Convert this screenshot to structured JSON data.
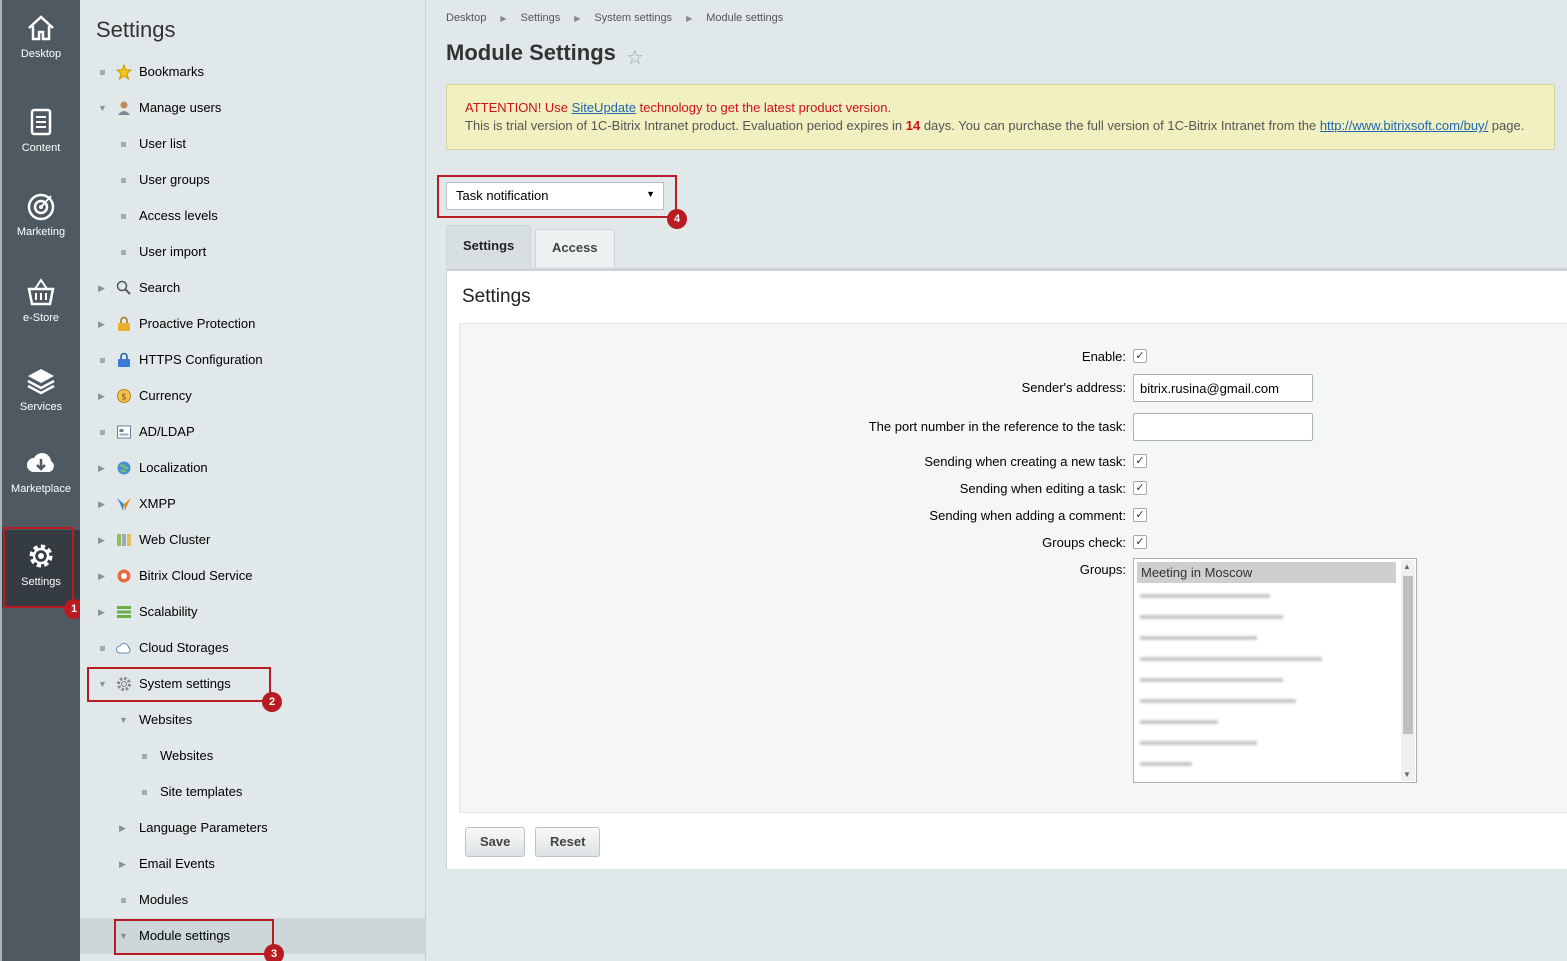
{
  "rail": {
    "items": [
      {
        "label": "Desktop",
        "icon": "home-icon"
      },
      {
        "label": "Content",
        "icon": "document-icon"
      },
      {
        "label": "Marketing",
        "icon": "target-icon"
      },
      {
        "label": "e-Store",
        "icon": "basket-icon"
      },
      {
        "label": "Services",
        "icon": "layers-icon"
      },
      {
        "label": "Marketplace",
        "icon": "cloud-download-icon"
      },
      {
        "label": "Settings",
        "icon": "gear-icon",
        "active": true
      }
    ]
  },
  "tree": {
    "title": "Settings",
    "items": [
      {
        "label": "Bookmarks"
      },
      {
        "label": "Manage users"
      },
      {
        "label": "User list"
      },
      {
        "label": "User groups"
      },
      {
        "label": "Access levels"
      },
      {
        "label": "User import"
      },
      {
        "label": "Search"
      },
      {
        "label": "Proactive Protection"
      },
      {
        "label": "HTTPS Configuration"
      },
      {
        "label": "Currency"
      },
      {
        "label": "AD/LDAP"
      },
      {
        "label": "Localization"
      },
      {
        "label": "XMPP"
      },
      {
        "label": "Web Cluster"
      },
      {
        "label": "Bitrix Cloud Service"
      },
      {
        "label": "Scalability"
      },
      {
        "label": "Cloud Storages"
      },
      {
        "label": "System settings"
      },
      {
        "label": "Websites"
      },
      {
        "label": "Websites"
      },
      {
        "label": "Site templates"
      },
      {
        "label": "Language Parameters"
      },
      {
        "label": "Email Events"
      },
      {
        "label": "Modules"
      },
      {
        "label": "Module settings"
      }
    ]
  },
  "breadcrumb": [
    "Desktop",
    "Settings",
    "System settings",
    "Module settings"
  ],
  "page": {
    "title": "Module Settings"
  },
  "notice": {
    "attention": "ATTENTION! Use ",
    "link1": "SiteUpdate",
    "after_link1": " technology to get the latest product version.",
    "line2_a": "This is trial version of 1C-Bitrix Intranet product. Evaluation period expires in ",
    "days": "14",
    "line2_b": " days. You can purchase the full version of 1C-Bitrix Intranet from the ",
    "link2": "http://www.bitrixsoft.com/buy/",
    "line2_c": " page."
  },
  "module_select": {
    "value": "Task notification"
  },
  "tabs": [
    {
      "label": "Settings",
      "active": true
    },
    {
      "label": "Access",
      "active": false
    }
  ],
  "panel": {
    "title": "Settings"
  },
  "form": {
    "enable_label": "Enable:",
    "sender_label": "Sender's address:",
    "sender_value": "bitrix.rusina@gmail.com",
    "port_label": "The port number in the reference to the task:",
    "port_value": "",
    "creating_label": "Sending when creating a new task:",
    "editing_label": "Sending when editing a task:",
    "comment_label": "Sending when adding a comment:",
    "groups_check_label": "Groups check:",
    "groups_label": "Groups:",
    "groups_selected": "Meeting in Moscow",
    "enable": true,
    "creating": true,
    "editing": true,
    "comment": true,
    "groups_check": true
  },
  "buttons": {
    "save": "Save",
    "reset": "Reset"
  },
  "annotations": [
    "1",
    "2",
    "3",
    "4"
  ],
  "colors": {
    "annotation": "#b81c22",
    "rail": "#4e5961",
    "link": "#2067b0"
  }
}
